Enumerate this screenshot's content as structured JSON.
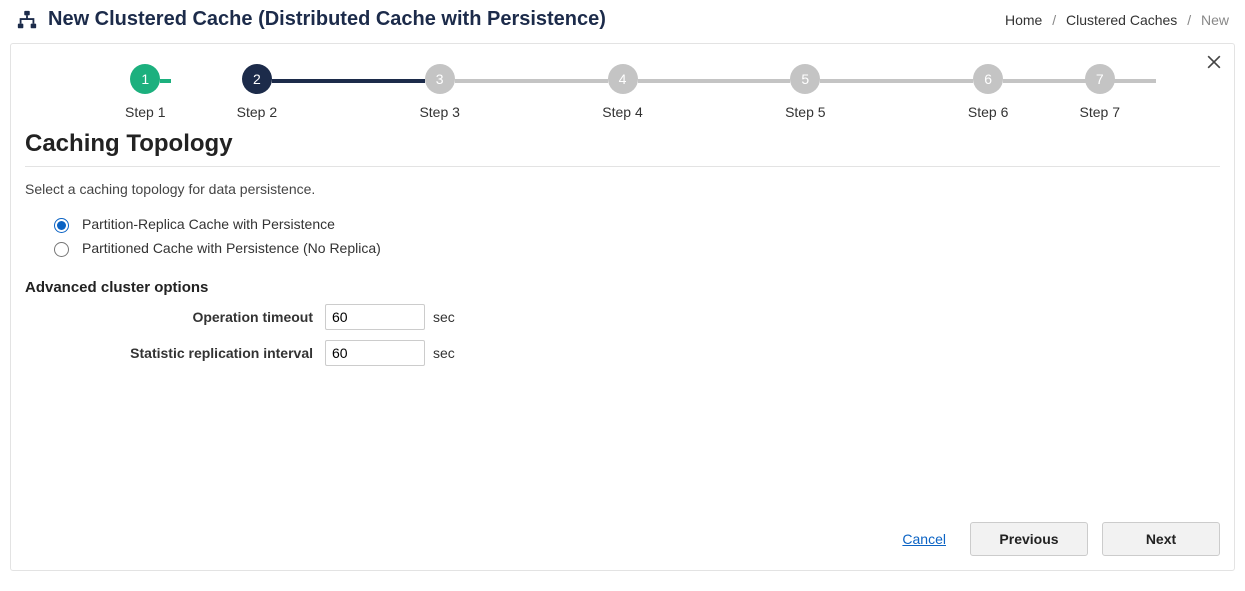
{
  "header": {
    "title": "New Clustered Cache (Distributed Cache with Persistence)"
  },
  "breadcrumb": {
    "home": "Home",
    "caches": "Clustered Caches",
    "current": "New"
  },
  "stepper": {
    "steps": [
      {
        "num": "1",
        "label": "Step 1",
        "state": "done"
      },
      {
        "num": "2",
        "label": "Step 2",
        "state": "active"
      },
      {
        "num": "3",
        "label": "Step 3",
        "state": "pending"
      },
      {
        "num": "4",
        "label": "Step 4",
        "state": "pending"
      },
      {
        "num": "5",
        "label": "Step 5",
        "state": "pending"
      },
      {
        "num": "6",
        "label": "Step 6",
        "state": "pending"
      },
      {
        "num": "7",
        "label": "Step 7",
        "state": "pending"
      }
    ]
  },
  "section": {
    "title": "Caching Topology",
    "subtitle": "Select a caching topology for data persistence."
  },
  "topology": {
    "options": [
      {
        "label": "Partition-Replica Cache with Persistence",
        "selected": true
      },
      {
        "label": "Partitioned Cache with Persistence (No Replica)",
        "selected": false
      }
    ]
  },
  "advanced": {
    "title": "Advanced cluster options",
    "operation_timeout_label": "Operation timeout",
    "operation_timeout_value": "60",
    "operation_timeout_unit": "sec",
    "replication_interval_label": "Statistic replication interval",
    "replication_interval_value": "60",
    "replication_interval_unit": "sec"
  },
  "footer": {
    "cancel": "Cancel",
    "previous": "Previous",
    "next": "Next"
  }
}
